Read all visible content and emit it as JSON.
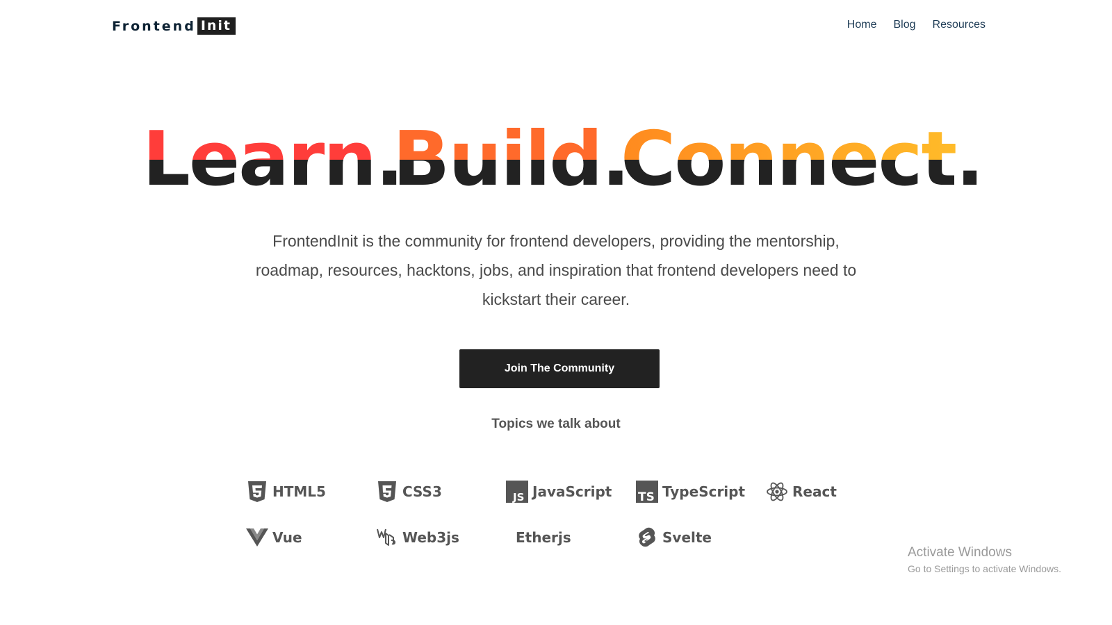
{
  "header": {
    "logo_word": "Frontend",
    "logo_badge": "Init",
    "nav": [
      {
        "label": "Home"
      },
      {
        "label": "Blog"
      },
      {
        "label": "Resources"
      }
    ]
  },
  "hero": {
    "headline_parts": [
      "Learn.",
      "Build.",
      "Connect."
    ],
    "description": "FrontendInit is the community for frontend developers, providing the mentorship, roadmap, resources, hacktons, jobs, and inspiration that frontend developers need to kickstart their career.",
    "cta_label": "Join The Community",
    "colors": {
      "learn": "#ff3d3a",
      "build": "#ff6a2b",
      "connect_start": "#ff8a1f",
      "connect_end": "#ffbf2a",
      "dark": "#222222"
    }
  },
  "topics": {
    "title": "Topics we talk about",
    "items": [
      {
        "label": "HTML5",
        "icon": "html5-icon"
      },
      {
        "label": "CSS3",
        "icon": "css3-icon"
      },
      {
        "label": "JavaScript",
        "icon": "javascript-icon"
      },
      {
        "label": "TypeScript",
        "icon": "typescript-icon"
      },
      {
        "label": "React",
        "icon": "react-icon"
      },
      {
        "label": "Vue",
        "icon": "vue-icon"
      },
      {
        "label": "Web3js",
        "icon": "web3js-icon"
      },
      {
        "label": "Etherjs",
        "icon": ""
      },
      {
        "label": "Svelte",
        "icon": "svelte-icon"
      }
    ]
  },
  "watermark": {
    "title": "Activate Windows",
    "subtitle": "Go to Settings to activate Windows."
  }
}
